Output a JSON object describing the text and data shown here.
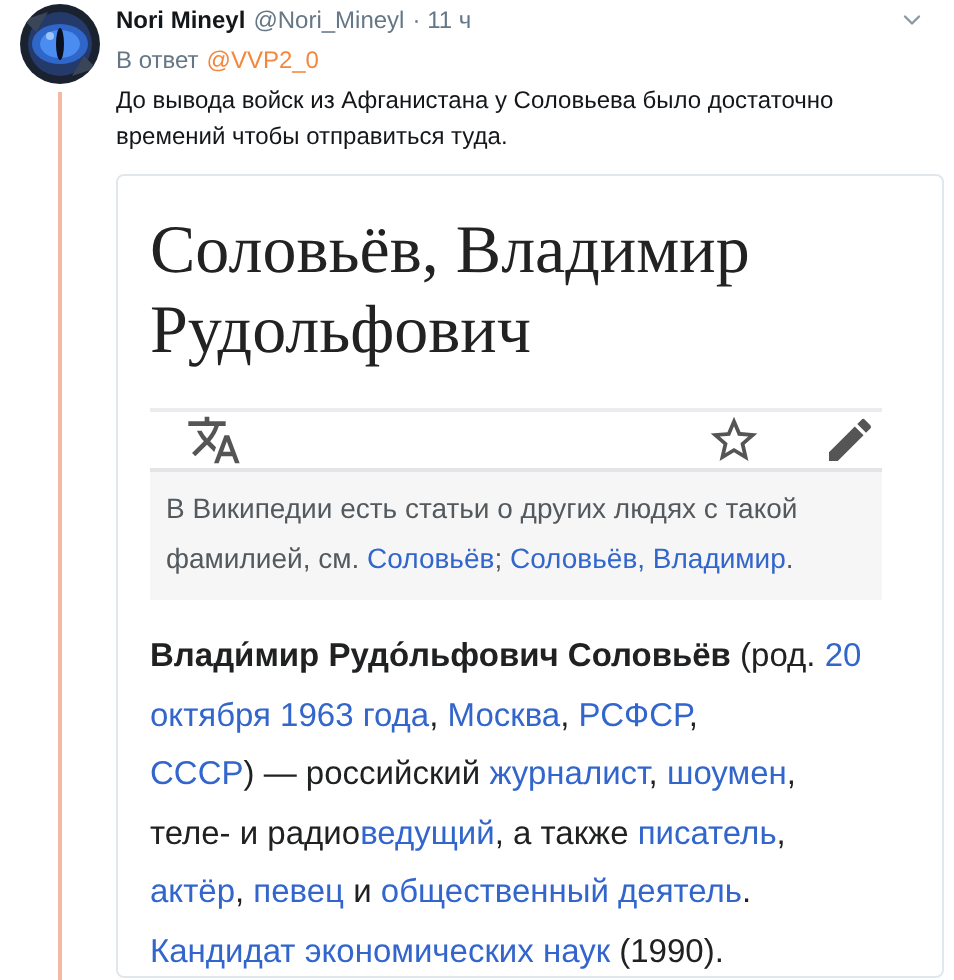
{
  "tweet": {
    "author": "Nori Mineyl",
    "handle": "@Nori_Mineyl",
    "time": "· 11 ч",
    "reply_prefix": "В ответ",
    "reply_to": "@VVP2_0",
    "text": "До вывода войск из Афганистана у Соловьева было достаточно времений чтобы отправиться туда."
  },
  "article": {
    "title": "Соловьёв, Владимир Рудольфович",
    "hatnote": [
      {
        "kind": "text",
        "text": "В Википедии есть статьи о других людях с такой фамилией, см. "
      },
      {
        "kind": "link",
        "text": "Соловьёв"
      },
      {
        "kind": "text",
        "text": "; "
      },
      {
        "kind": "link",
        "text": "Соловьёв, Владимир"
      },
      {
        "kind": "text",
        "text": "."
      }
    ],
    "lead_lines": [
      [
        {
          "kind": "bold",
          "text": "Влади́мир Рудо́льфович Соловьёв"
        },
        {
          "kind": "text",
          "text": " (род. "
        },
        {
          "kind": "link",
          "text": "20"
        }
      ],
      [
        {
          "kind": "link",
          "text": "октября 1963 года"
        },
        {
          "kind": "text",
          "text": ", "
        },
        {
          "kind": "link",
          "text": "Москва"
        },
        {
          "kind": "text",
          "text": ", "
        },
        {
          "kind": "link",
          "text": "РСФСР"
        },
        {
          "kind": "text",
          "text": ","
        }
      ],
      [
        {
          "kind": "link",
          "text": "СССР"
        },
        {
          "kind": "text",
          "text": ") — российский "
        },
        {
          "kind": "link",
          "text": "журналист"
        },
        {
          "kind": "text",
          "text": ", "
        },
        {
          "kind": "link",
          "text": "шоумен"
        },
        {
          "kind": "text",
          "text": ","
        }
      ],
      [
        {
          "kind": "text",
          "text": "теле- и радио"
        },
        {
          "kind": "link",
          "text": "ведущий"
        },
        {
          "kind": "text",
          "text": ", а также "
        },
        {
          "kind": "link",
          "text": "писатель"
        },
        {
          "kind": "text",
          "text": ","
        }
      ],
      [
        {
          "kind": "link",
          "text": "актёр"
        },
        {
          "kind": "text",
          "text": ", "
        },
        {
          "kind": "link",
          "text": "певец"
        },
        {
          "kind": "text",
          "text": " и "
        },
        {
          "kind": "link",
          "text": "общественный деятель"
        },
        {
          "kind": "text",
          "text": "."
        }
      ],
      [
        {
          "kind": "link",
          "text": "Кандидат экономических наук"
        },
        {
          "kind": "text",
          "text": " (1990)."
        }
      ]
    ]
  }
}
